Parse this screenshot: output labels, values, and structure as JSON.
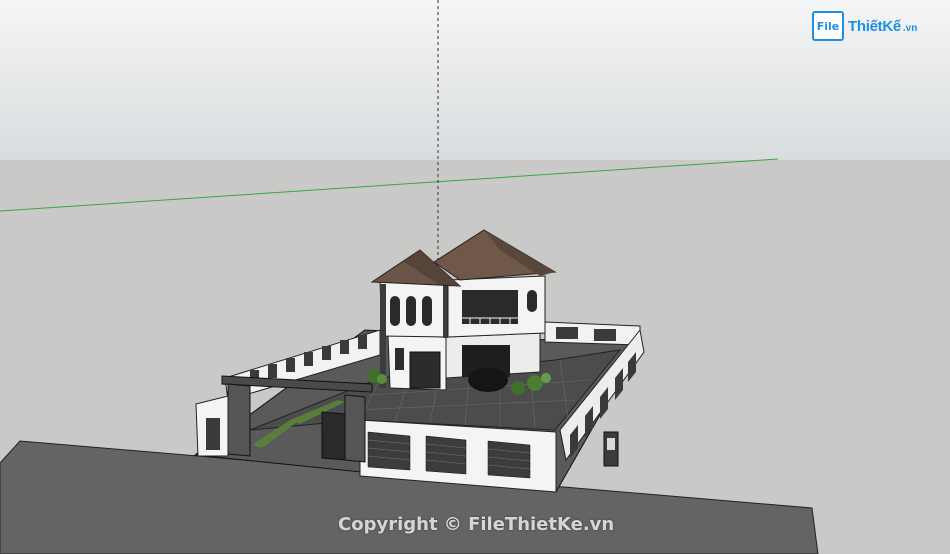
{
  "logo": {
    "badge": "File",
    "text": "ThiếtKế",
    "suffix": ".vn"
  },
  "watermark": "Copyright © FileThietKe.vn",
  "colors": {
    "sky_top": "#f4f5f6",
    "sky_bottom": "#d9dcde",
    "ground": "#c9c9c7",
    "road": "#646464",
    "axis_green": "#3aa53a",
    "roof": "#6b5548",
    "wall": "#f4f4f2",
    "paving": "#4b4b4b",
    "accent_blue": "#1f8fe0"
  }
}
